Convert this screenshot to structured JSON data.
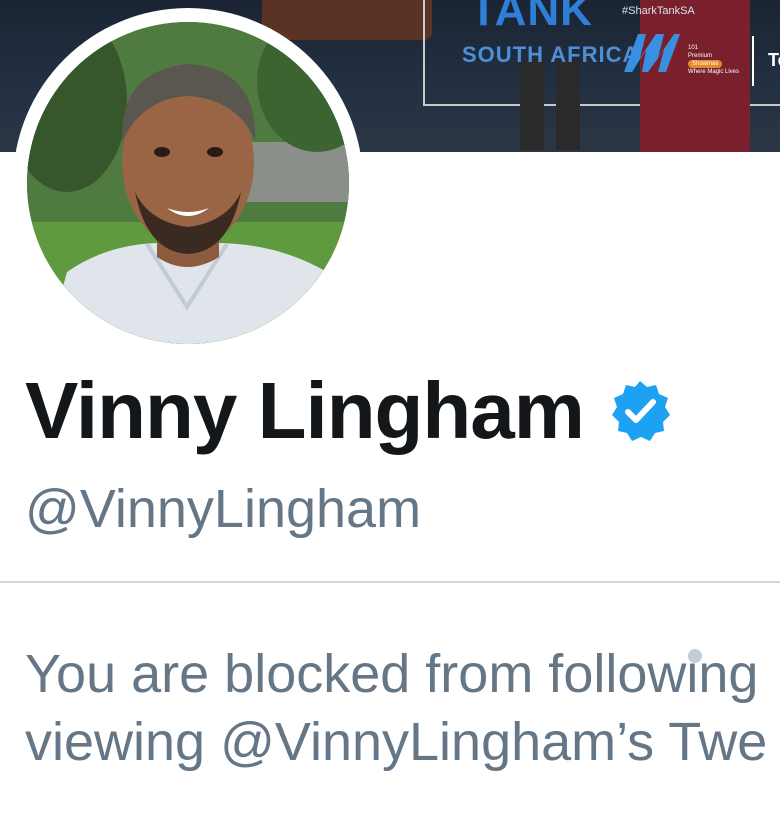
{
  "banner": {
    "show_title": "TANK",
    "show_subtitle": "SOUTH AFRICA",
    "hashtag": "#SharkTankSA",
    "channel_number": "101",
    "channel_tier": "Premium",
    "channel_name": "Showmax",
    "channel_tagline": "Where Magic Lives",
    "corner_text": "Te"
  },
  "profile": {
    "avatar_icon": "profile-photo",
    "name": "Vinny Lingham",
    "verified_icon": "verified-badge-icon",
    "verified_color": "#1da1f2",
    "handle": "@VinnyLingham"
  },
  "notice": {
    "line1": "You are blocked from following",
    "line2": "viewing @VinnyLingham’s Twe"
  },
  "colors": {
    "name": "#14171a",
    "secondary_text": "#657786",
    "divider": "#cfd7de"
  }
}
